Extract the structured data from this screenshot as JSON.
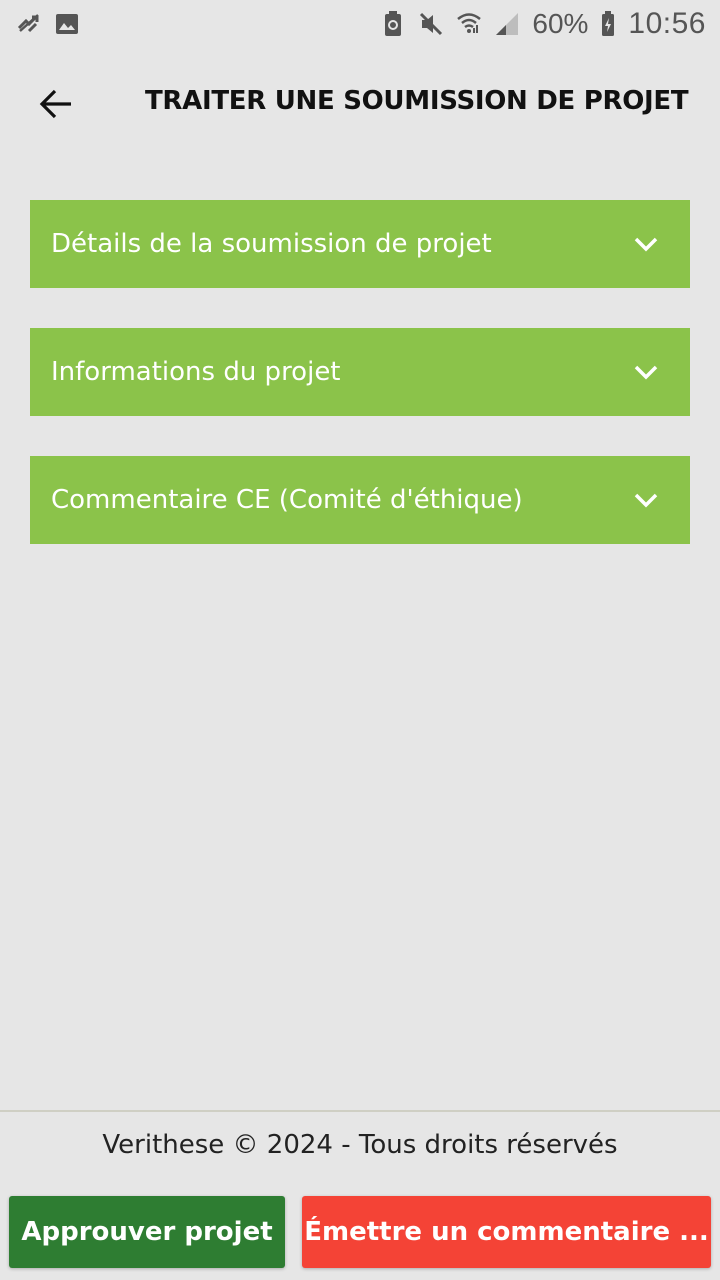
{
  "status_bar": {
    "icons_left": [
      "sync-disabled-icon",
      "image-icon"
    ],
    "icons_right": [
      "battery-saver-icon",
      "mute-icon",
      "wifi-icon",
      "signal-icon"
    ],
    "battery_percent": "60%",
    "time": "10:56"
  },
  "header": {
    "back_icon": "arrow-left-icon",
    "title": "TRAITER UNE SOUMISSION DE PROJET"
  },
  "accordion": {
    "items": [
      {
        "label": "Détails de la soumission de projet",
        "expanded": false
      },
      {
        "label": "Informations du projet",
        "expanded": false
      },
      {
        "label": "Commentaire CE (Comité d'éthique)",
        "expanded": false
      }
    ]
  },
  "footer": {
    "copyright": "Verithese © 2024 - Tous droits réservés"
  },
  "actions": {
    "approve_label": "Approuver projet",
    "comment_label": "Émettre un commentaire ..."
  },
  "colors": {
    "background": "#e6e6e6",
    "accordion": "#8bc34a",
    "approve": "#2e7d32",
    "comment": "#f44336"
  }
}
